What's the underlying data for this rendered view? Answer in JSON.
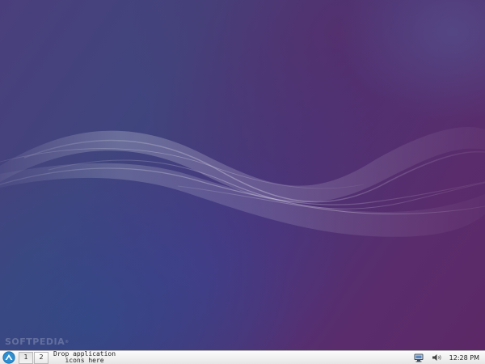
{
  "desktop": {
    "wallpaper": "purple-blue-waves",
    "watermark": "SOFTPEDIA",
    "watermark_mark": "®"
  },
  "panel": {
    "menu_icon": "lubuntu-logo-icon",
    "workspaces": [
      {
        "label": "1",
        "active": true
      },
      {
        "label": "2",
        "active": false
      }
    ],
    "launcher": {
      "line1": "Drop application",
      "line2": "icons here"
    },
    "tray": {
      "network_icon": "network-icon",
      "volume_icon": "volume-icon"
    },
    "clock": "12:28 PM"
  },
  "colors": {
    "panel": "#f0f0f0",
    "wallpaper_dark": "#40457e",
    "wallpaper_purple": "#5c2866",
    "menu_icon": "#2f8fd0"
  }
}
